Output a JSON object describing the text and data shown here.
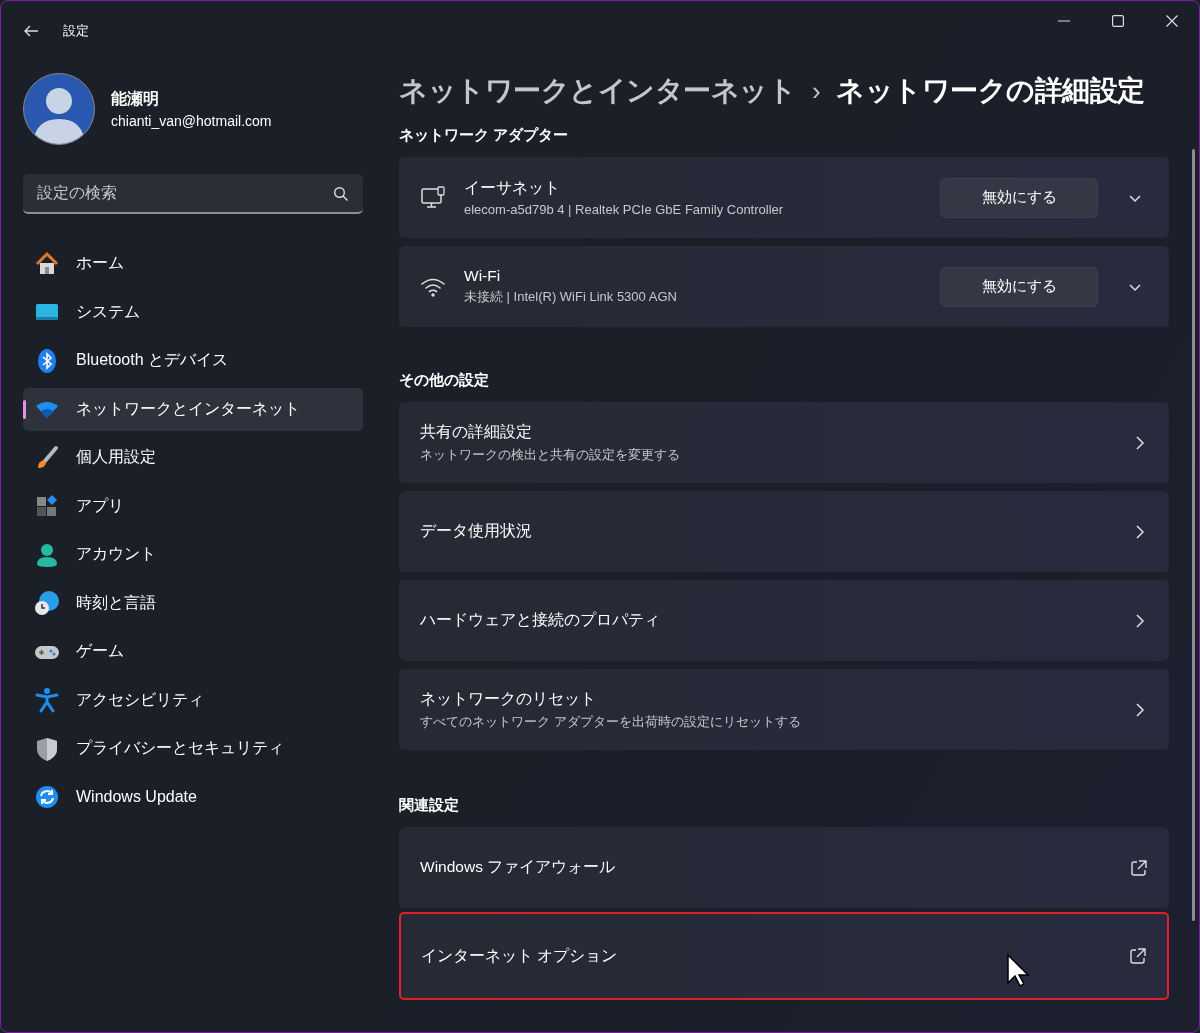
{
  "window": {
    "title": "設定"
  },
  "profile": {
    "name": "能瀬明",
    "email": "chianti_van@hotmail.com"
  },
  "search": {
    "placeholder": "設定の検索"
  },
  "sidebar": {
    "items": [
      {
        "label": "ホーム",
        "selected": false
      },
      {
        "label": "システム",
        "selected": false
      },
      {
        "label": "Bluetooth とデバイス",
        "selected": false
      },
      {
        "label": "ネットワークとインターネット",
        "selected": true
      },
      {
        "label": "個人用設定",
        "selected": false
      },
      {
        "label": "アプリ",
        "selected": false
      },
      {
        "label": "アカウント",
        "selected": false
      },
      {
        "label": "時刻と言語",
        "selected": false
      },
      {
        "label": "ゲーム",
        "selected": false
      },
      {
        "label": "アクセシビリティ",
        "selected": false
      },
      {
        "label": "プライバシーとセキュリティ",
        "selected": false
      },
      {
        "label": "Windows Update",
        "selected": false
      }
    ]
  },
  "breadcrumb": {
    "parent": "ネットワークとインターネット",
    "separator": "›",
    "current": "ネットワークの詳細設定"
  },
  "sections": [
    {
      "heading": "ネットワーク アダプター",
      "cards": [
        {
          "kind": "adapter",
          "title": "イーサネット",
          "subtitle": "elecom-a5d79b 4 | Realtek PCIe GbE Family Controller",
          "button": "無効にする",
          "expanded": false,
          "highlighted": false
        },
        {
          "kind": "adapter",
          "title": "Wi-Fi",
          "subtitle": "未接続 | Intel(R) WiFi Link 5300 AGN",
          "button": "無効にする",
          "expanded": false,
          "highlighted": false
        }
      ]
    },
    {
      "heading": "その他の設定",
      "cards": [
        {
          "kind": "nav",
          "title": "共有の詳細設定",
          "subtitle": "ネットワークの検出と共有の設定を変更する",
          "highlighted": false
        },
        {
          "kind": "nav",
          "title": "データ使用状況",
          "highlighted": false
        },
        {
          "kind": "nav",
          "title": "ハードウェアと接続のプロパティ",
          "highlighted": false
        },
        {
          "kind": "nav",
          "title": "ネットワークのリセット",
          "subtitle": "すべてのネットワーク アダプターを出荷時の設定にリセットする",
          "highlighted": false
        }
      ]
    },
    {
      "heading": "関連設定",
      "cards": [
        {
          "kind": "external",
          "title": "Windows ファイアウォール",
          "highlighted": false
        },
        {
          "kind": "external",
          "title": "インターネット オプション",
          "highlighted": true
        }
      ]
    }
  ]
}
